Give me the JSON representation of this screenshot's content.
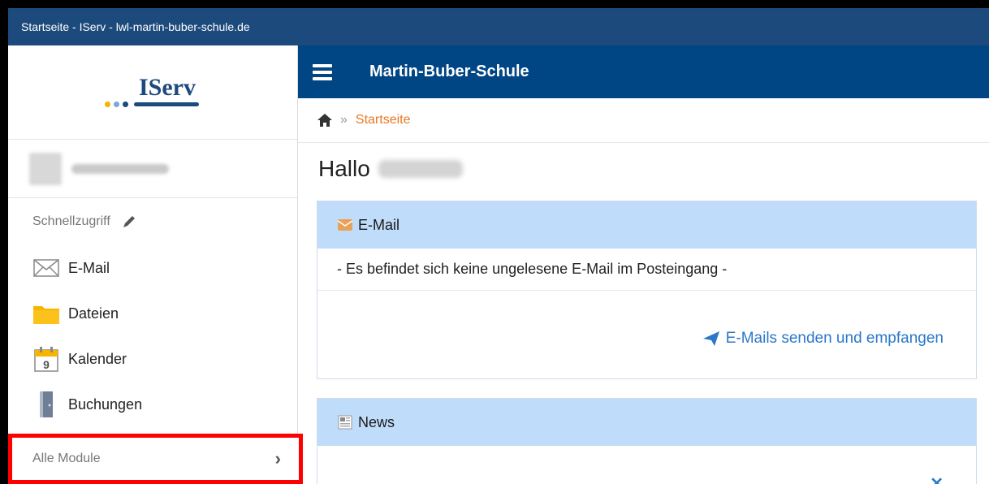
{
  "window": {
    "title": "Startseite - IServ - lwl-martin-buber-schule.de"
  },
  "brand": {
    "logo_text": "IServ",
    "school_name": "Martin-Buber-Schule"
  },
  "breadcrumb": {
    "current": "Startseite",
    "separator": "»"
  },
  "sidebar": {
    "quick_access_label": "Schnellzugriff",
    "items": [
      {
        "label": "E-Mail",
        "icon": "envelope-icon"
      },
      {
        "label": "Dateien",
        "icon": "folder-icon"
      },
      {
        "label": "Kalender",
        "icon": "calendar-icon",
        "day": "9"
      },
      {
        "label": "Buchungen",
        "icon": "door-icon"
      }
    ],
    "all_modules_label": "Alle Module",
    "all_modules_chevron": "›"
  },
  "main": {
    "greeting": "Hallo",
    "mail": {
      "title": "E-Mail",
      "message": "- Es befindet sich keine ungelesene E-Mail im Posteingang -",
      "action": "E-Mails senden und empfangen"
    },
    "news": {
      "title": "News",
      "close": "✕"
    }
  },
  "colors": {
    "titlebar": "#1d4a7c",
    "topbar": "#004584",
    "accent": "#e87722",
    "panel_head": "#bfdcfa",
    "link": "#2c78c8",
    "highlight": "#ff0000"
  }
}
